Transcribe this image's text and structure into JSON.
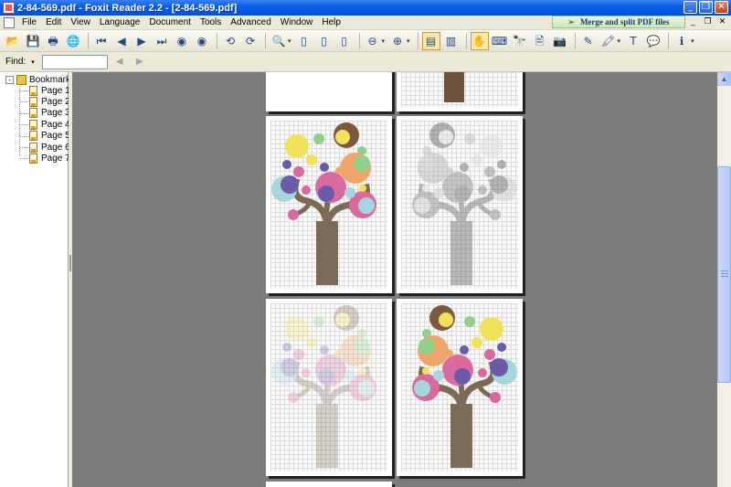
{
  "window": {
    "title": "2-84-569.pdf - Foxit Reader 2.2 - [2-84-569.pdf]",
    "controls": [
      "_",
      "❐",
      "✕"
    ]
  },
  "menu": {
    "items": [
      "File",
      "Edit",
      "View",
      "Language",
      "Document",
      "Tools",
      "Advanced",
      "Window",
      "Help"
    ],
    "promo": "Merge and split PDF files",
    "doc_controls": [
      "_",
      "❐",
      "✕"
    ]
  },
  "toolbar": {
    "buttons": [
      {
        "name": "open-icon",
        "glyph": "📂"
      },
      {
        "name": "save-icon",
        "glyph": "💾"
      },
      {
        "name": "print-icon",
        "glyph": "🖶"
      },
      {
        "name": "web-icon",
        "glyph": "🌐"
      },
      {
        "name": "first-page-icon",
        "glyph": "⏮"
      },
      {
        "name": "prev-page-icon",
        "glyph": "◀"
      },
      {
        "name": "next-page-icon",
        "glyph": "▶"
      },
      {
        "name": "last-page-icon",
        "glyph": "⏭"
      },
      {
        "name": "go-back-icon",
        "glyph": "◉"
      },
      {
        "name": "go-forward-icon",
        "glyph": "◉"
      },
      {
        "name": "rotate-left-icon",
        "glyph": "⟲"
      },
      {
        "name": "rotate-right-icon",
        "glyph": "⟳"
      },
      {
        "name": "zoom-icon",
        "glyph": "🔍"
      },
      {
        "name": "actual-size-icon",
        "glyph": "▯"
      },
      {
        "name": "fit-page-icon",
        "glyph": "▯"
      },
      {
        "name": "fit-width-icon",
        "glyph": "▯"
      },
      {
        "name": "zoom-out-icon",
        "glyph": "⊖"
      },
      {
        "name": "zoom-in-icon",
        "glyph": "⊕"
      },
      {
        "name": "bookmarks-panel-icon",
        "glyph": "▤"
      },
      {
        "name": "thumbnail-panel-icon",
        "glyph": "▥"
      },
      {
        "name": "hand-tool-icon",
        "glyph": "✋"
      },
      {
        "name": "select-text-icon",
        "glyph": "⌨"
      },
      {
        "name": "find-icon",
        "glyph": "🔭"
      },
      {
        "name": "select-image-icon",
        "glyph": "🖹"
      },
      {
        "name": "snapshot-icon",
        "glyph": "📷"
      },
      {
        "name": "annotation-icon",
        "glyph": "✎"
      },
      {
        "name": "highlight-icon",
        "glyph": "🖍"
      },
      {
        "name": "typewriter-icon",
        "glyph": "T"
      },
      {
        "name": "note-icon",
        "glyph": "💬"
      },
      {
        "name": "info-icon",
        "glyph": "ℹ"
      }
    ]
  },
  "find": {
    "label": "Find:",
    "dropdown": "▾",
    "value": "",
    "prev": "◀",
    "next": "▶"
  },
  "bookmarks": {
    "root_label": "Bookmarks",
    "expander": "-",
    "items": [
      "Page 1",
      "Page 2",
      "Page 3",
      "Page 4",
      "Page 5",
      "Page 6",
      "Page 7"
    ]
  },
  "scrollbar": {
    "up_arrow": "▲"
  },
  "colors": {
    "titlebar": "#0a5fe6",
    "viewer_bg": "#7c7c7c",
    "promo_bg": "#d8efca",
    "trunk": "#7b6a55",
    "circle_pink": "#d86a9e",
    "circle_yellow": "#f1e25a",
    "circle_brown": "#7c5a3e",
    "circle_green": "#8fd08a",
    "circle_blue": "#a8d4dc",
    "circle_purple": "#6a5aa8",
    "circle_orange": "#f0a66a"
  }
}
